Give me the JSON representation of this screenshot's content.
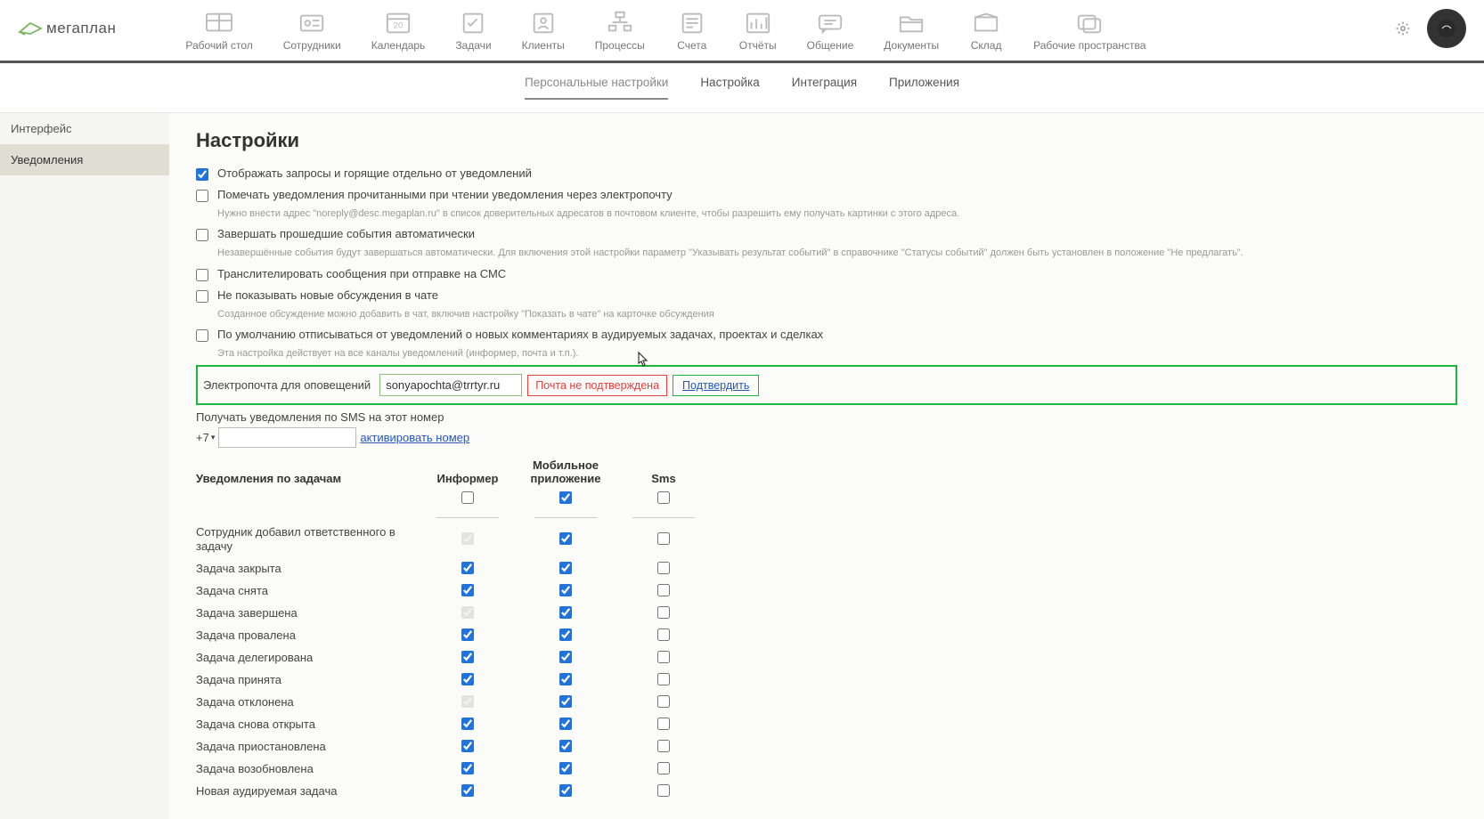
{
  "logo": {
    "text": "мегаплан"
  },
  "nav": [
    {
      "label": "Рабочий стол"
    },
    {
      "label": "Сотрудники"
    },
    {
      "label": "Календарь"
    },
    {
      "label": "Задачи"
    },
    {
      "label": "Клиенты"
    },
    {
      "label": "Процессы"
    },
    {
      "label": "Счета"
    },
    {
      "label": "Отчёты"
    },
    {
      "label": "Общение"
    },
    {
      "label": "Документы"
    },
    {
      "label": "Склад"
    },
    {
      "label": "Рабочие пространства"
    }
  ],
  "subnav": [
    {
      "label": "Персональные настройки",
      "active": true
    },
    {
      "label": "Настройка"
    },
    {
      "label": "Интеграция"
    },
    {
      "label": "Приложения"
    }
  ],
  "sidebar": [
    {
      "label": "Интерфейс"
    },
    {
      "label": "Уведомления",
      "active": true
    }
  ],
  "page_title": "Настройки",
  "options": [
    {
      "label": "Отображать запросы и горящие отдельно от уведомлений",
      "checked": true
    },
    {
      "label": "Помечать уведомления прочитанными при чтении уведомления через электропочту",
      "checked": false,
      "hint": "Нужно внести адрес \"noreply@desc.megaplan.ru\" в список доверительных адресатов в почтовом клиенте, чтобы разрешить ему получать картинки с этого адреса."
    },
    {
      "label": "Завершать прошедшие события автоматически",
      "checked": false,
      "hint": "Незавершённые события будут завершаться автоматически.\nДля включения этой настройки параметр \"Указывать результат событий\" в справочнике \"Статусы событий\" должен быть установлен в положение \"Не предлагать\"."
    },
    {
      "label": "Транслителировать сообщения при отправке на СМС",
      "checked": false
    },
    {
      "label": "Не показывать новые обсуждения в чате",
      "checked": false,
      "hint": "Созданное обсуждение можно добавить в чат, включив настройку \"Показать в чате\" на карточке обсуждения"
    },
    {
      "label": "По умолчанию отписываться от уведомлений о новых комментариях в аудируемых задачах, проектах и сделках",
      "checked": false,
      "hint": "Эта настройка действует на все каналы уведомлений (информер, почта и т.п.)."
    }
  ],
  "email": {
    "label": "Электропочта для оповещений",
    "value": "sonyapochta@trrtyr.ru",
    "warn": "Почта не подтверждена",
    "confirm": "Подтвердить"
  },
  "sms": {
    "label": "Получать уведомления по SMS на этот номер",
    "prefix": "+7",
    "value": "",
    "activate": "активировать номер"
  },
  "notif_table": {
    "header": {
      "label": "Уведомления по задачам",
      "col1": "Информер",
      "col2": "Мобильное приложение",
      "col3": "Sms"
    },
    "master_row": {
      "informer": false,
      "mobile": true,
      "sms": false
    },
    "rows": [
      {
        "label": "Сотрудник добавил ответственного в задачу",
        "informer": true,
        "informer_disabled": true,
        "mobile": true,
        "sms": false
      },
      {
        "label": "Задача закрыта",
        "informer": true,
        "mobile": true,
        "sms": false
      },
      {
        "label": "Задача снята",
        "informer": true,
        "mobile": true,
        "sms": false
      },
      {
        "label": "Задача завершена",
        "informer": true,
        "informer_disabled": true,
        "mobile": true,
        "sms": false
      },
      {
        "label": "Задача провалена",
        "informer": true,
        "mobile": true,
        "sms": false
      },
      {
        "label": "Задача делегирована",
        "informer": true,
        "mobile": true,
        "sms": false
      },
      {
        "label": "Задача принята",
        "informer": true,
        "mobile": true,
        "sms": false
      },
      {
        "label": "Задача отклонена",
        "informer": true,
        "informer_disabled": true,
        "mobile": true,
        "sms": false
      },
      {
        "label": "Задача снова открыта",
        "informer": true,
        "mobile": true,
        "sms": false
      },
      {
        "label": "Задача приостановлена",
        "informer": true,
        "mobile": true,
        "sms": false
      },
      {
        "label": "Задача возобновлена",
        "informer": true,
        "mobile": true,
        "sms": false
      },
      {
        "label": "Новая аудируемая задача",
        "informer": true,
        "mobile": true,
        "sms": false
      }
    ]
  }
}
